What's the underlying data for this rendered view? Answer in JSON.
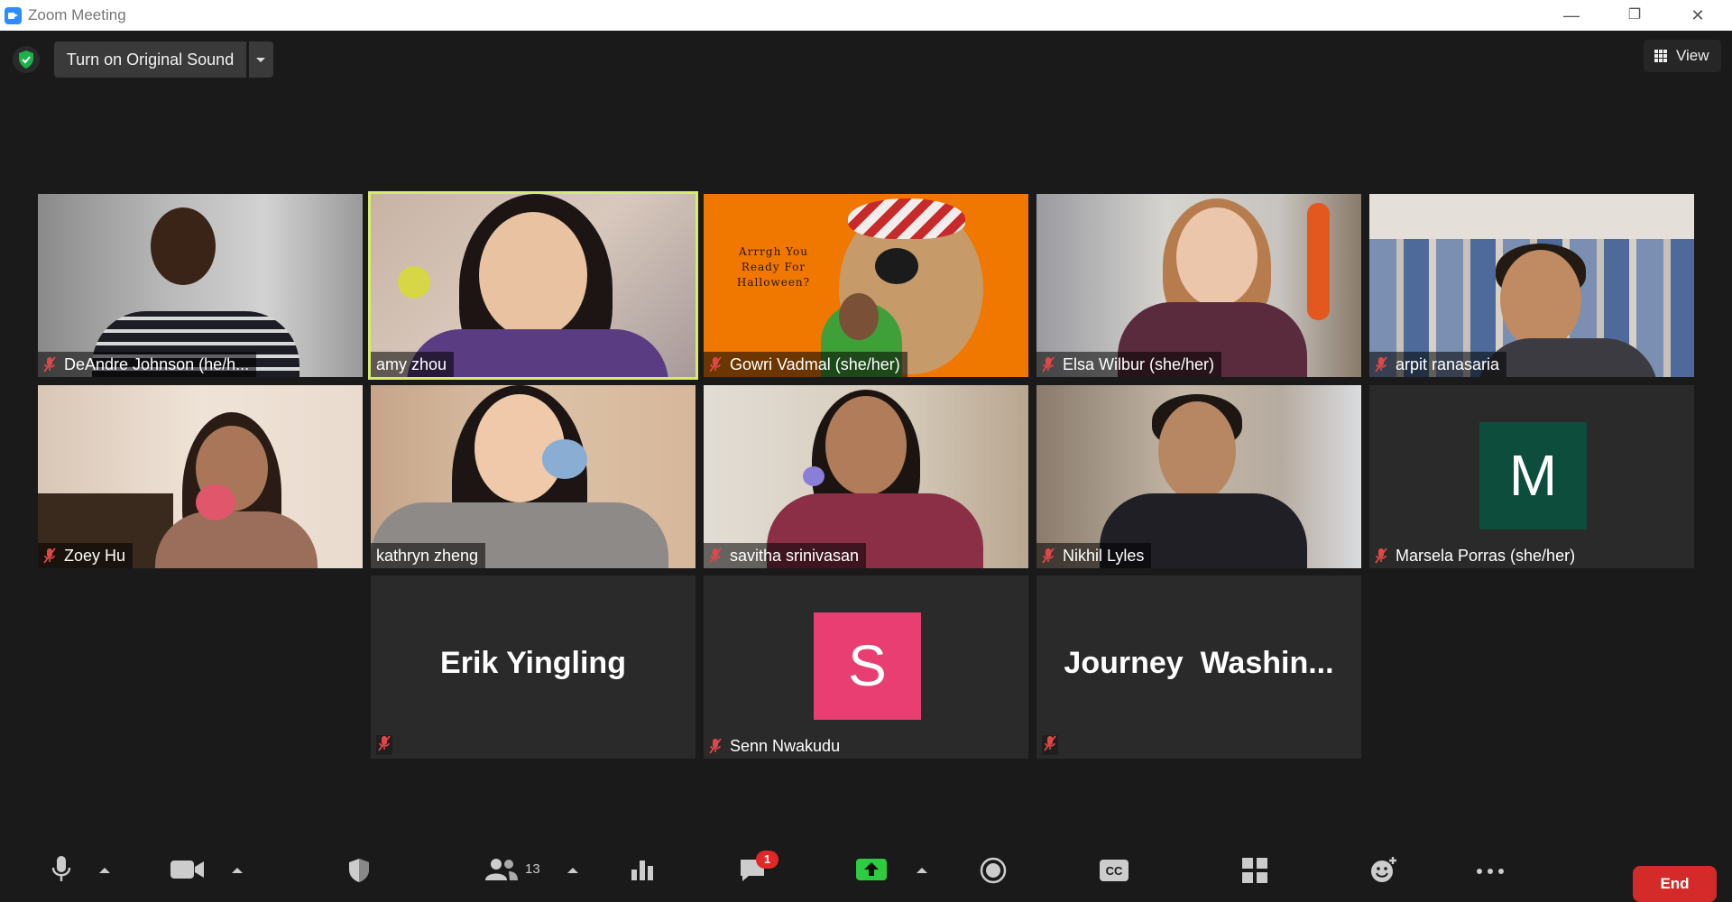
{
  "window": {
    "title": "Zoom Meeting",
    "minimize": "—",
    "restore": "❐",
    "close": "✕"
  },
  "top": {
    "original_sound": "Turn on Original Sound",
    "view": "View"
  },
  "tiles": [
    {
      "name": "DeAndre Johnson (he/h..."
    },
    {
      "name": "amy zhou"
    },
    {
      "name": "Gowri Vadmal (she/her)",
      "bg_text": "Arrrgh You Ready For Halloween?"
    },
    {
      "name": "Elsa Wilbur (she/her)"
    },
    {
      "name": "arpit ranasaria"
    },
    {
      "name": "Zoey Hu"
    },
    {
      "name": "kathryn zheng"
    },
    {
      "name": "savitha srinivasan"
    },
    {
      "name": "Nikhil Lyles"
    },
    {
      "name": "Marsela Porras (she/her)",
      "avatar_letter": "M",
      "avatar_color": "#0c4d3c"
    },
    {
      "display": "Erik Yingling"
    },
    {
      "name": "Senn Nwakudu",
      "avatar_letter": "S",
      "avatar_color": "#e83e72"
    },
    {
      "display": "Journey  Washin..."
    }
  ],
  "toolbar": {
    "participants_count": "13",
    "chat_badge": "1",
    "end": "End",
    "colors": {
      "share": "#2ecc40",
      "end": "#d42a2a",
      "active_speaker": "#d7ec6a"
    }
  }
}
